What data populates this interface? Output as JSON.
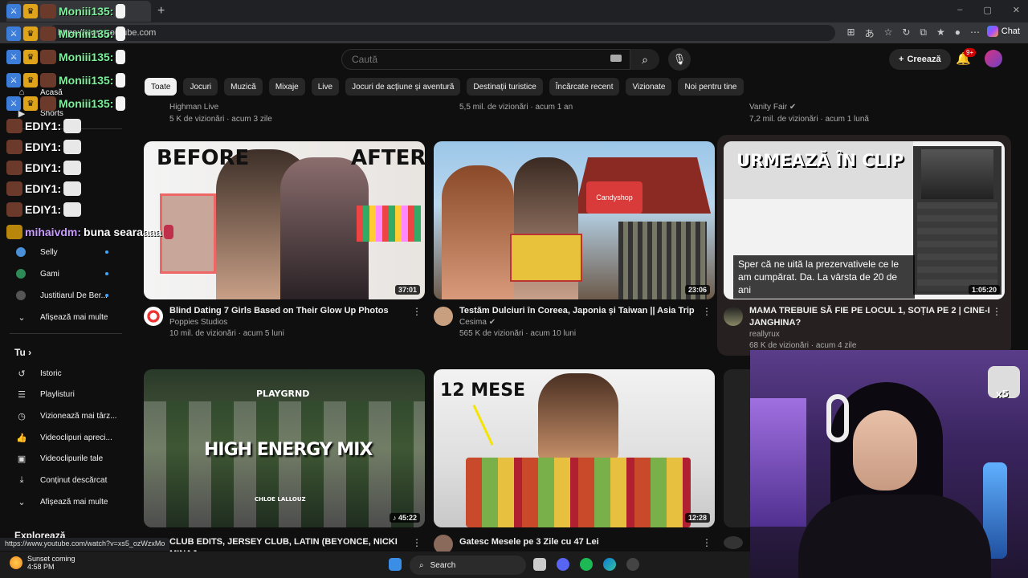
{
  "browser": {
    "tab_title": "",
    "new_tab": "+",
    "url": "https://www.youtube.com",
    "chat_label": "Chat",
    "window_controls": [
      "–",
      "▢",
      "✕"
    ]
  },
  "header": {
    "search_placeholder": "Caută",
    "create_label": "Creează",
    "notifications": "9+"
  },
  "chips": [
    "Toate",
    "Jocuri",
    "Muzică",
    "Mixaje",
    "Live",
    "Jocuri de acțiune și aventură",
    "Destinații turistice",
    "Încărcate recent",
    "Vizionate",
    "Noi pentru tine"
  ],
  "sidebar": {
    "top": [
      {
        "label": "Acasă",
        "icon": "home-icon"
      },
      {
        "label": "Shorts",
        "icon": "shorts-icon"
      }
    ],
    "subscriptions": [
      {
        "label": "Selly",
        "color": "#4a90d9"
      },
      {
        "label": "Gami",
        "color": "#2e8b57"
      },
      {
        "label": "Justitiarul De Ber...",
        "color": "#555555"
      }
    ],
    "show_more": "Afișează mai multe",
    "you_header": "Tu",
    "you_items": [
      {
        "label": "Istoric",
        "icon": "history-icon"
      },
      {
        "label": "Playlisturi",
        "icon": "playlist-icon"
      },
      {
        "label": "Vizionează mai târz...",
        "icon": "clock-icon"
      },
      {
        "label": "Videoclipuri apreci...",
        "icon": "thumbs-up-icon"
      },
      {
        "label": "Videoclipurile tale",
        "icon": "video-icon"
      },
      {
        "label": "Conținut descărcat",
        "icon": "download-icon"
      },
      {
        "label": "Afișează mai multe",
        "icon": "chevron-down-icon"
      }
    ],
    "explore_header": "Explorează"
  },
  "chat": [
    {
      "user": "Moniii135:",
      "color": "green"
    },
    {
      "user": "Moniii135:",
      "color": "green"
    },
    {
      "user": "Moniii135:",
      "color": "green"
    },
    {
      "user": "Moniii135:",
      "color": "green"
    },
    {
      "user": "Moniii135:",
      "color": "green"
    },
    {
      "user": "EDIY1:",
      "color": "white"
    },
    {
      "user": "EDIY1:",
      "color": "white"
    },
    {
      "user": "EDIY1:",
      "color": "white"
    },
    {
      "user": "EDIY1:",
      "color": "white"
    },
    {
      "user": "EDIY1:",
      "color": "white"
    },
    {
      "user": "mihaivdm:",
      "color": "purple",
      "message": "buna searaaaa"
    }
  ],
  "top_row_meta": [
    {
      "channel": "Highman Live",
      "stats": "5 K de vizionări · acum 3 zile"
    },
    {
      "channel": "",
      "stats": "5,5 mil. de vizionări · acum 1 an"
    },
    {
      "channel": "Vanity Fair",
      "stats": "7,2 mil. de vizionări · acum 1 lună"
    }
  ],
  "videos": [
    {
      "title": "Blind Dating 7 Girls Based on Their Glow Up Photos",
      "channel": "Poppies Studios",
      "stats": "10 mil. de vizionări · acum 5 luni",
      "duration": "37:01",
      "thumb_left": "BEFORE",
      "thumb_right": "AFTER"
    },
    {
      "title": "Testăm Dulciuri în Coreea, Japonia și Taiwan || Asia Trip",
      "channel": "Cesima",
      "stats": "565 K de vizionări · acum 10 luni",
      "duration": "23:06",
      "thumb_sign": "Candyshop"
    },
    {
      "title": "MAMA TREBUIE SĂ FIE PE LOCUL 1, SOȚIA PE 2 | CINE-I JANGHINA?",
      "channel": "reallyrux",
      "stats": "68 K de vizionări · acum 4 zile",
      "duration": "1:05:20",
      "thumb_header": "URMEAZĂ ÎN CLIP",
      "caption": "Sper că ne uită la prezervativele ce le am cumpărat. Da. La vârsta de 20 de ani"
    },
    {
      "title": "CLUB EDITS, JERSEY CLUB, LATIN (BEYONCE, NICKI MINAJ,",
      "channel": "",
      "stats": "",
      "duration": "45:22",
      "thumb_brand": "PLAYGRND",
      "thumb_title": "HIGH ENERGY MIX",
      "thumb_artist": "CHLOE LALLOUZ"
    },
    {
      "title": "Gatesc Mesele pe 3 Zile cu 47 Lei",
      "channel": "",
      "stats": "",
      "duration": "12:28",
      "thumb_title": "12 MESE"
    }
  ],
  "status_url": "https://www.youtube.com/watch?v=xs5_ozWzxMo",
  "taskbar": {
    "weather": "Sunset coming",
    "time": "4:58 PM",
    "search": "Search"
  },
  "webcam_overlay": "x5"
}
